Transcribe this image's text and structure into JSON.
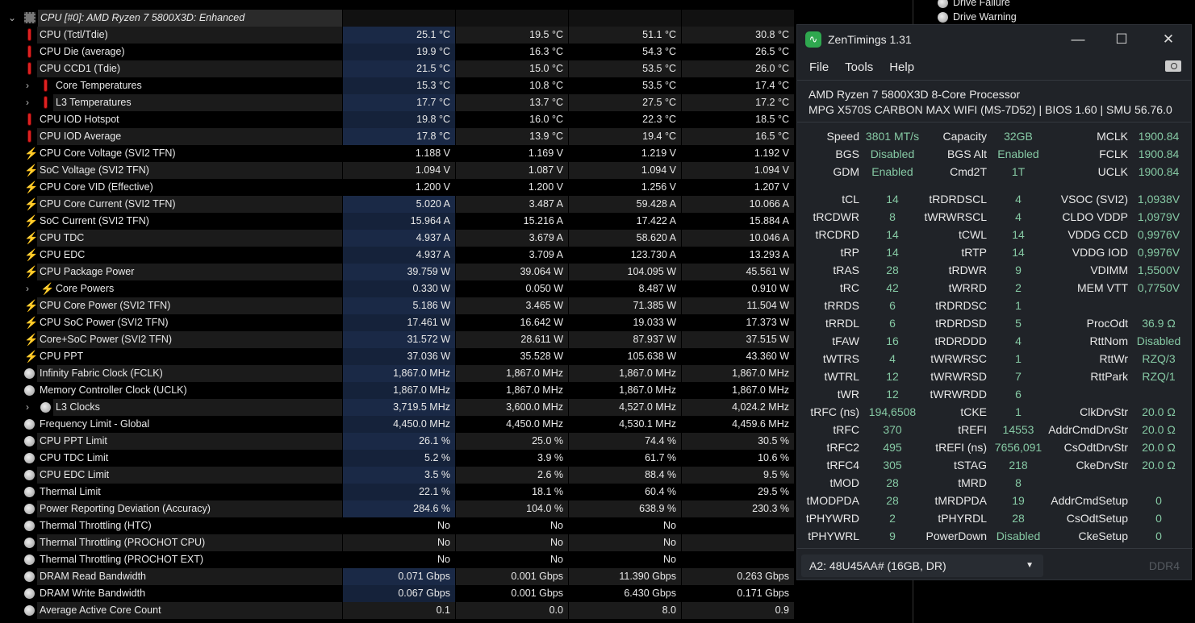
{
  "sensors": {
    "header": {
      "label": "CPU [#0]: AMD Ryzen 7 5800X3D: Enhanced",
      "icon": "chip-icon"
    },
    "rows": [
      {
        "label": "CPU (Tctl/Tdie)",
        "icon": "therm",
        "v": [
          "25.1 °C",
          "19.5 °C",
          "51.1 °C",
          "30.8 °C"
        ],
        "hl": true
      },
      {
        "label": "CPU Die (average)",
        "icon": "therm",
        "v": [
          "19.9 °C",
          "16.3 °C",
          "54.3 °C",
          "26.5 °C"
        ],
        "hl": true
      },
      {
        "label": "CPU CCD1 (Tdie)",
        "icon": "therm",
        "v": [
          "21.5 °C",
          "15.0 °C",
          "53.5 °C",
          "26.0 °C"
        ],
        "hl": true
      },
      {
        "label": "Core Temperatures",
        "icon": "therm",
        "sub": true,
        "v": [
          "15.3 °C",
          "10.8 °C",
          "53.5 °C",
          "17.4 °C"
        ],
        "hl": true
      },
      {
        "label": "L3 Temperatures",
        "icon": "therm",
        "sub": true,
        "v": [
          "17.7 °C",
          "13.7 °C",
          "27.5 °C",
          "17.2 °C"
        ],
        "hl": true
      },
      {
        "label": "CPU IOD Hotspot",
        "icon": "therm",
        "v": [
          "19.8 °C",
          "16.0 °C",
          "22.3 °C",
          "18.5 °C"
        ],
        "hl": true
      },
      {
        "label": "CPU IOD Average",
        "icon": "therm",
        "v": [
          "17.8 °C",
          "13.9 °C",
          "19.4 °C",
          "16.5 °C"
        ],
        "hl": true
      },
      {
        "label": "CPU Core Voltage (SVI2 TFN)",
        "icon": "bolt",
        "v": [
          "1.188 V",
          "1.169 V",
          "1.219 V",
          "1.192 V"
        ]
      },
      {
        "label": "SoC Voltage (SVI2 TFN)",
        "icon": "bolt",
        "v": [
          "1.094 V",
          "1.087 V",
          "1.094 V",
          "1.094 V"
        ]
      },
      {
        "label": "CPU Core VID (Effective)",
        "icon": "bolt",
        "v": [
          "1.200 V",
          "1.200 V",
          "1.256 V",
          "1.207 V"
        ]
      },
      {
        "label": "CPU Core Current (SVI2 TFN)",
        "icon": "bolt",
        "v": [
          "5.020 A",
          "3.487 A",
          "59.428 A",
          "10.066 A"
        ],
        "hl": true
      },
      {
        "label": "SoC Current (SVI2 TFN)",
        "icon": "bolt",
        "v": [
          "15.964 A",
          "15.216 A",
          "17.422 A",
          "15.884 A"
        ],
        "hl": true
      },
      {
        "label": "CPU TDC",
        "icon": "bolt",
        "v": [
          "4.937 A",
          "3.679 A",
          "58.620 A",
          "10.046 A"
        ],
        "hl": true
      },
      {
        "label": "CPU EDC",
        "icon": "bolt",
        "v": [
          "4.937 A",
          "3.709 A",
          "123.730 A",
          "13.293 A"
        ],
        "hl": true
      },
      {
        "label": "CPU Package Power",
        "icon": "bolt",
        "v": [
          "39.759 W",
          "39.064 W",
          "104.095 W",
          "45.561 W"
        ],
        "hl": true
      },
      {
        "label": "Core Powers",
        "icon": "bolt",
        "sub": true,
        "v": [
          "0.330 W",
          "0.050 W",
          "8.487 W",
          "0.910 W"
        ],
        "hl": true
      },
      {
        "label": "CPU Core Power (SVI2 TFN)",
        "icon": "bolt",
        "v": [
          "5.186 W",
          "3.465 W",
          "71.385 W",
          "11.504 W"
        ],
        "hl": true
      },
      {
        "label": "CPU SoC Power (SVI2 TFN)",
        "icon": "bolt",
        "v": [
          "17.461 W",
          "16.642 W",
          "19.033 W",
          "17.373 W"
        ],
        "hl": true
      },
      {
        "label": "Core+SoC Power (SVI2 TFN)",
        "icon": "bolt",
        "v": [
          "31.572 W",
          "28.611 W",
          "87.937 W",
          "37.515 W"
        ],
        "hl": true
      },
      {
        "label": "CPU PPT",
        "icon": "bolt",
        "v": [
          "37.036 W",
          "35.528 W",
          "105.638 W",
          "43.360 W"
        ],
        "hl": true
      },
      {
        "label": "Infinity Fabric Clock (FCLK)",
        "icon": "clock",
        "v": [
          "1,867.0 MHz",
          "1,867.0 MHz",
          "1,867.0 MHz",
          "1,867.0 MHz"
        ],
        "hl": true
      },
      {
        "label": "Memory Controller Clock (UCLK)",
        "icon": "clock",
        "v": [
          "1,867.0 MHz",
          "1,867.0 MHz",
          "1,867.0 MHz",
          "1,867.0 MHz"
        ],
        "hl": true
      },
      {
        "label": "L3 Clocks",
        "icon": "clock",
        "sub": true,
        "v": [
          "3,719.5 MHz",
          "3,600.0 MHz",
          "4,527.0 MHz",
          "4,024.2 MHz"
        ],
        "hl": true
      },
      {
        "label": "Frequency Limit - Global",
        "icon": "clock",
        "v": [
          "4,450.0 MHz",
          "4,450.0 MHz",
          "4,530.1 MHz",
          "4,459.6 MHz"
        ],
        "hl": true
      },
      {
        "label": "CPU PPT Limit",
        "icon": "clock",
        "v": [
          "26.1 %",
          "25.0 %",
          "74.4 %",
          "30.5 %"
        ],
        "hl": true
      },
      {
        "label": "CPU TDC Limit",
        "icon": "clock",
        "v": [
          "5.2 %",
          "3.9 %",
          "61.7 %",
          "10.6 %"
        ],
        "hl": true
      },
      {
        "label": "CPU EDC Limit",
        "icon": "clock",
        "v": [
          "3.5 %",
          "2.6 %",
          "88.4 %",
          "9.5 %"
        ],
        "hl": true
      },
      {
        "label": "Thermal Limit",
        "icon": "clock",
        "v": [
          "22.1 %",
          "18.1 %",
          "60.4 %",
          "29.5 %"
        ],
        "hl": true
      },
      {
        "label": "Power Reporting Deviation (Accuracy)",
        "icon": "clock",
        "v": [
          "284.6 %",
          "104.0 %",
          "638.9 %",
          "230.3 %"
        ],
        "hl": true
      },
      {
        "label": "Thermal Throttling (HTC)",
        "icon": "clock",
        "v": [
          "No",
          "No",
          "No",
          ""
        ]
      },
      {
        "label": "Thermal Throttling (PROCHOT CPU)",
        "icon": "clock",
        "v": [
          "No",
          "No",
          "No",
          ""
        ]
      },
      {
        "label": "Thermal Throttling (PROCHOT EXT)",
        "icon": "clock",
        "v": [
          "No",
          "No",
          "No",
          ""
        ]
      },
      {
        "label": "DRAM Read Bandwidth",
        "icon": "clock",
        "v": [
          "0.071 Gbps",
          "0.001 Gbps",
          "11.390 Gbps",
          "0.263 Gbps"
        ],
        "hl": true
      },
      {
        "label": "DRAM Write Bandwidth",
        "icon": "clock",
        "v": [
          "0.067 Gbps",
          "0.001 Gbps",
          "6.430 Gbps",
          "0.171 Gbps"
        ],
        "hl": true
      },
      {
        "label": "Average Active Core Count",
        "icon": "clock",
        "v": [
          "0.1",
          "0.0",
          "8.0",
          "0.9"
        ]
      }
    ]
  },
  "tree": [
    "Drive Failure",
    "Drive Warning"
  ],
  "zentimings": {
    "title": "ZenTimings 1.31",
    "menu": [
      "File",
      "Tools",
      "Help"
    ],
    "cpu": "AMD Ryzen 7 5800X3D 8-Core Processor",
    "board": "MPG X570S CARBON MAX WIFI (MS-7D52) | BIOS 1.60 | SMU 56.76.0",
    "top": [
      [
        "Speed",
        "3801 MT/s",
        "Capacity",
        "32GB",
        "MCLK",
        "1900.84"
      ],
      [
        "BGS",
        "Disabled",
        "BGS Alt",
        "Enabled",
        "FCLK",
        "1900.84"
      ],
      [
        "GDM",
        "Enabled",
        "Cmd2T",
        "1T",
        "UCLK",
        "1900.84"
      ]
    ],
    "timings": [
      [
        "tCL",
        "14",
        "tRDRDSCL",
        "4",
        "VSOC (SVI2)",
        "1,0938V"
      ],
      [
        "tRCDWR",
        "8",
        "tWRWRSCL",
        "4",
        "CLDO VDDP",
        "1,0979V"
      ],
      [
        "tRCDRD",
        "14",
        "tCWL",
        "14",
        "VDDG CCD",
        "0,9976V"
      ],
      [
        "tRP",
        "14",
        "tRTP",
        "14",
        "VDDG IOD",
        "0,9976V"
      ],
      [
        "tRAS",
        "28",
        "tRDWR",
        "9",
        "VDIMM",
        "1,5500V"
      ],
      [
        "tRC",
        "42",
        "tWRRD",
        "2",
        "MEM VTT",
        "0,7750V"
      ],
      [
        "tRRDS",
        "6",
        "tRDRDSC",
        "1",
        "",
        ""
      ],
      [
        "tRRDL",
        "6",
        "tRDRDSD",
        "5",
        "ProcOdt",
        "36.9 Ω"
      ],
      [
        "tFAW",
        "16",
        "tRDRDDD",
        "4",
        "RttNom",
        "Disabled"
      ],
      [
        "tWTRS",
        "4",
        "tWRWRSC",
        "1",
        "RttWr",
        "RZQ/3"
      ],
      [
        "tWTRL",
        "12",
        "tWRWRSD",
        "7",
        "RttPark",
        "RZQ/1"
      ],
      [
        "tWR",
        "12",
        "tWRWRDD",
        "6",
        "",
        ""
      ],
      [
        "tRFC (ns)",
        "194,6508",
        "tCKE",
        "1",
        "ClkDrvStr",
        "20.0 Ω"
      ],
      [
        "tRFC",
        "370",
        "tREFI",
        "14553",
        "AddrCmdDrvStr",
        "20.0 Ω"
      ],
      [
        "tRFC2",
        "495",
        "tREFI (ns)",
        "7656,091",
        "CsOdtDrvStr",
        "20.0 Ω"
      ],
      [
        "tRFC4",
        "305",
        "tSTAG",
        "218",
        "CkeDrvStr",
        "20.0 Ω"
      ],
      [
        "tMOD",
        "28",
        "tMRD",
        "8",
        "",
        ""
      ],
      [
        "tMODPDA",
        "28",
        "tMRDPDA",
        "19",
        "AddrCmdSetup",
        "0"
      ],
      [
        "tPHYWRD",
        "2",
        "tPHYRDL",
        "28",
        "CsOdtSetup",
        "0"
      ],
      [
        "tPHYWRL",
        "9",
        "PowerDown",
        "Disabled",
        "CkeSetup",
        "0"
      ]
    ],
    "module": "A2: 48U45AA# (16GB, DR)",
    "memtype": "DDR4"
  }
}
